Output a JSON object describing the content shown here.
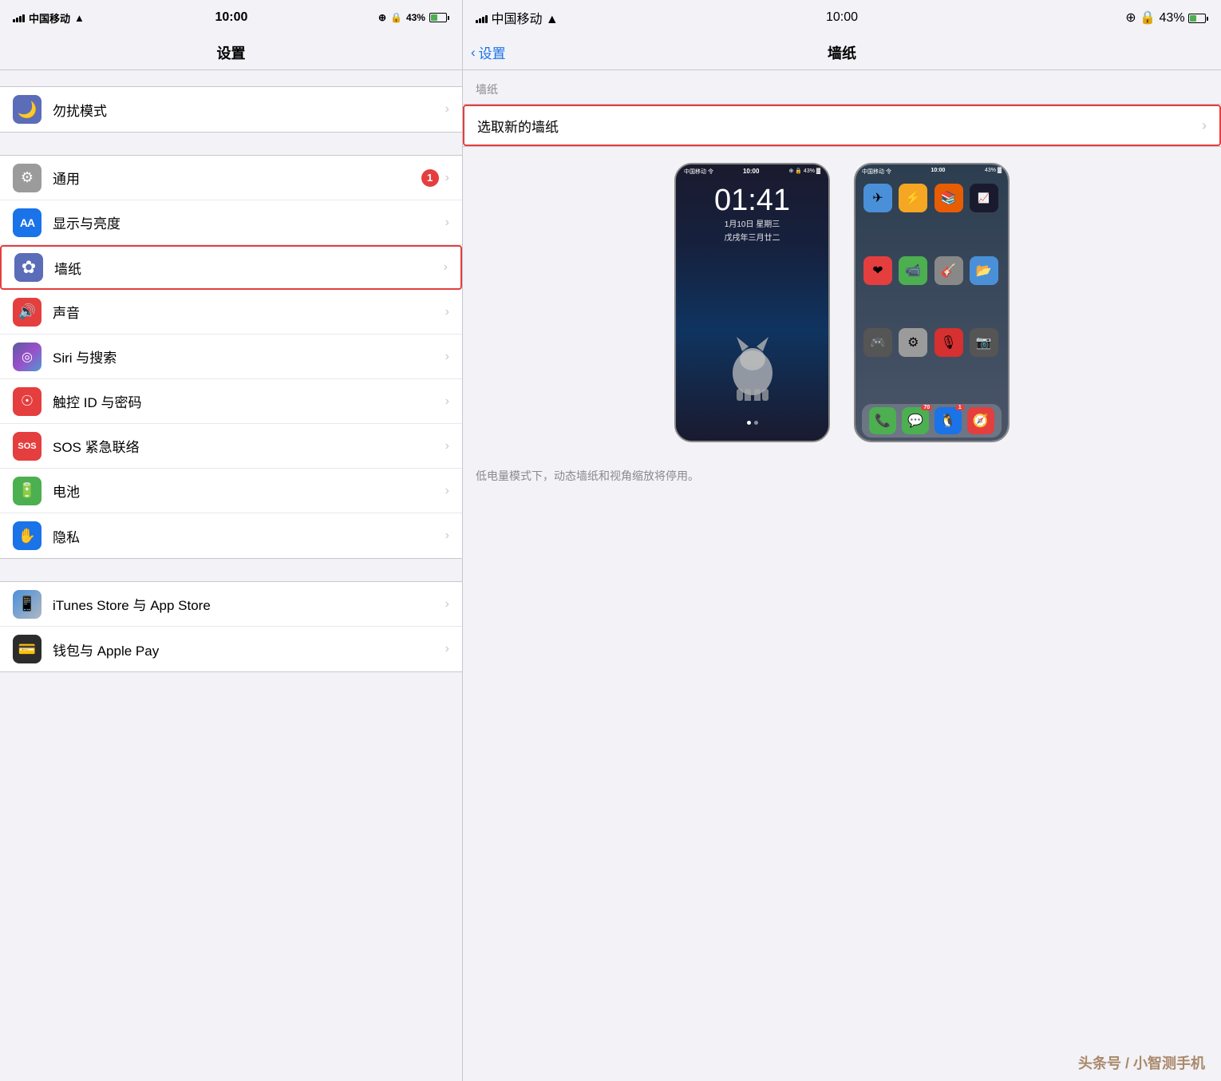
{
  "left": {
    "statusBar": {
      "carrier": "中国移动",
      "wifi": "WiFi",
      "time": "10:00",
      "battery": "43%"
    },
    "title": "设置",
    "sections": [
      {
        "items": [
          {
            "id": "dnd",
            "icon": "🌙",
            "iconClass": "icon-dnd",
            "label": "勿扰模式",
            "badge": null,
            "highlighted": false
          }
        ]
      },
      {
        "items": [
          {
            "id": "general",
            "icon": "⚙️",
            "iconClass": "icon-general",
            "label": "通用",
            "badge": "1",
            "highlighted": false
          },
          {
            "id": "display",
            "icon": "AA",
            "iconClass": "icon-display",
            "label": "显示与亮度",
            "badge": null,
            "highlighted": false
          },
          {
            "id": "wallpaper",
            "icon": "✿",
            "iconClass": "icon-wallpaper",
            "label": "墙纸",
            "badge": null,
            "highlighted": true
          },
          {
            "id": "sound",
            "icon": "🔊",
            "iconClass": "icon-sound",
            "label": "声音",
            "badge": null,
            "highlighted": false
          },
          {
            "id": "siri",
            "icon": "◎",
            "iconClass": "icon-siri",
            "label": "Siri 与搜索",
            "badge": null,
            "highlighted": false
          },
          {
            "id": "touchid",
            "icon": "☉",
            "iconClass": "icon-touchid",
            "label": "触控 ID 与密码",
            "badge": null,
            "highlighted": false
          },
          {
            "id": "sos",
            "icon": "SOS",
            "iconClass": "icon-sos",
            "label": "SOS 紧急联络",
            "badge": null,
            "highlighted": false
          },
          {
            "id": "battery",
            "icon": "🔋",
            "iconClass": "icon-battery",
            "label": "电池",
            "badge": null,
            "highlighted": false
          },
          {
            "id": "privacy",
            "icon": "✋",
            "iconClass": "icon-privacy",
            "label": "隐私",
            "badge": null,
            "highlighted": false
          }
        ]
      },
      {
        "items": [
          {
            "id": "itunes",
            "icon": "📱",
            "iconClass": "icon-itunes",
            "label": "iTunes Store 与 App Store",
            "badge": null,
            "highlighted": false
          },
          {
            "id": "wallet",
            "icon": "💳",
            "iconClass": "icon-wallet",
            "label": "钱包与 Apple Pay",
            "badge": null,
            "highlighted": false
          }
        ]
      }
    ]
  },
  "right": {
    "statusBar": {
      "carrier": "中国移动",
      "time": "10:00",
      "battery": "43%"
    },
    "backLabel": "设置",
    "title": "墙纸",
    "sectionHeader": "墙纸",
    "selectNewWallpaper": "选取新的墙纸",
    "noteText": "低电量模式下，动态墙纸和视角缩放将停用。",
    "lockscreen": {
      "time": "01:41",
      "date": "1月10日 星期三",
      "subdate": "戊戌年三月廿二"
    },
    "homescreen": {
      "apps": [
        {
          "icon": "✈",
          "bg": "#4a90d9",
          "label": "旅行"
        },
        {
          "icon": "⚡",
          "bg": "#f5a623",
          "label": "效率"
        },
        {
          "icon": "📚",
          "bg": "#e85d04",
          "label": "iBooks"
        },
        {
          "icon": "📈",
          "bg": "#333",
          "label": "股市"
        },
        {
          "icon": "❤",
          "bg": "#e53e3e",
          "label": "健康"
        },
        {
          "icon": "📹",
          "bg": "#4caf50",
          "label": "FaceTime"
        },
        {
          "icon": "🎸",
          "bg": "#888",
          "label": "GarageBand"
        },
        {
          "icon": "📂",
          "bg": "#4a90d9",
          "label": "文件夹"
        },
        {
          "icon": "🎮",
          "bg": "#555",
          "label": "游戏"
        },
        {
          "icon": "⚙",
          "bg": "#9b9b9b",
          "label": "设置"
        },
        {
          "icon": "🎙",
          "bg": "#d63031",
          "label": "播客"
        },
        {
          "icon": "📷",
          "bg": "#555",
          "label": "相机"
        }
      ],
      "dock": [
        {
          "icon": "📞",
          "bg": "#4caf50",
          "badge": null
        },
        {
          "icon": "💬",
          "bg": "#4caf50",
          "badge": "70"
        },
        {
          "icon": "🐧",
          "bg": "#1a73e8",
          "badge": "1"
        },
        {
          "icon": "🧭",
          "bg": "#e53e3e",
          "badge": null
        }
      ]
    }
  },
  "watermark": "头条号 / 小智测手机"
}
